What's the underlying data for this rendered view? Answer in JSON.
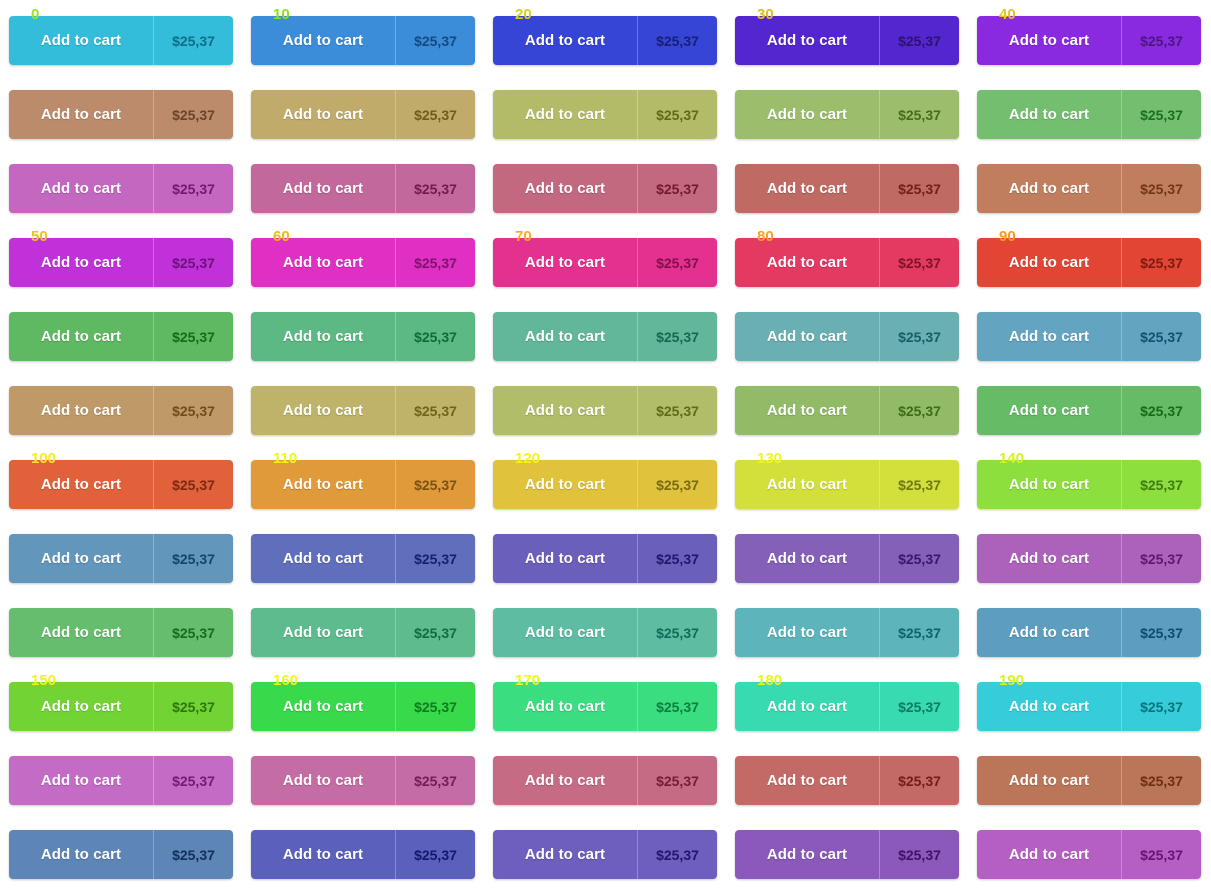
{
  "page": {
    "title": "Add to cart button color grid",
    "background": "#ffffff",
    "columns": 5,
    "rows": 12,
    "button_count": 60,
    "label_text": "Add to cart",
    "price_text": "$25,37",
    "label_text_color": "#ffffff",
    "index_label_stride": 10,
    "index_label_rows": [
      0,
      3,
      6,
      9
    ]
  },
  "buttons": [
    {
      "index": "0",
      "label": "Add to cart",
      "price": "$25,37",
      "bg": "#34bcdb",
      "price_color": "#0d6f86",
      "index_label": "0",
      "index_color": "#9ce61f"
    },
    {
      "index": "1",
      "label": "Add to cart",
      "price": "$25,37",
      "bg": "#3b8cd9",
      "price_color": "#124a80",
      "index_label": "10",
      "index_color": "#8ee01b"
    },
    {
      "index": "2",
      "label": "Add to cart",
      "price": "$25,37",
      "bg": "#3745d6",
      "price_color": "#161e78",
      "index_label": "20",
      "index_color": "#d8d315"
    },
    {
      "index": "3",
      "label": "Add to cart",
      "price": "$25,37",
      "bg": "#5426cf",
      "price_color": "#2c126f",
      "index_label": "30",
      "index_color": "#e0c014"
    },
    {
      "index": "4",
      "label": "Add to cart",
      "price": "$25,37",
      "bg": "#8a2ae0",
      "price_color": "#4a1680",
      "index_label": "40",
      "index_color": "#e8c419"
    },
    {
      "index": "5",
      "label": "Add to cart",
      "price": "$25,37",
      "bg": "#bb8b6b",
      "price_color": "#6b4428",
      "index_label": null,
      "index_color": null
    },
    {
      "index": "6",
      "label": "Add to cart",
      "price": "$25,37",
      "bg": "#c1ab6a",
      "price_color": "#6e5c19",
      "index_label": null,
      "index_color": null
    },
    {
      "index": "7",
      "label": "Add to cart",
      "price": "$25,37",
      "bg": "#b4bb68",
      "price_color": "#5e6a18",
      "index_label": null,
      "index_color": null
    },
    {
      "index": "8",
      "label": "Add to cart",
      "price": "$25,37",
      "bg": "#9cbd6c",
      "price_color": "#456d1c",
      "index_label": null,
      "index_color": null
    },
    {
      "index": "9",
      "label": "Add to cart",
      "price": "$25,37",
      "bg": "#74bf6f",
      "price_color": "#1c6e24",
      "index_label": null,
      "index_color": null
    },
    {
      "index": "10",
      "label": "Add to cart",
      "price": "$25,37",
      "bg": "#c367c1",
      "price_color": "#73186f",
      "index_label": null,
      "index_color": null
    },
    {
      "index": "11",
      "label": "Add to cart",
      "price": "$25,37",
      "bg": "#c2689d",
      "price_color": "#73194e",
      "index_label": null,
      "index_color": null
    },
    {
      "index": "12",
      "label": "Add to cart",
      "price": "$25,37",
      "bg": "#c2687f",
      "price_color": "#73182f",
      "index_label": null,
      "index_color": null
    },
    {
      "index": "13",
      "label": "Add to cart",
      "price": "$25,37",
      "bg": "#c06a64",
      "price_color": "#71211a",
      "index_label": null,
      "index_color": null
    },
    {
      "index": "14",
      "label": "Add to cart",
      "price": "$25,37",
      "bg": "#c07e5e",
      "price_color": "#703618",
      "index_label": null,
      "index_color": null
    },
    {
      "index": "15",
      "label": "Add to cart",
      "price": "$25,37",
      "bg": "#c031d9",
      "price_color": "#6a1279",
      "index_label": "50",
      "index_color": "#eec31c"
    },
    {
      "index": "16",
      "label": "Add to cart",
      "price": "$25,37",
      "bg": "#e030c4",
      "price_color": "#7d126b",
      "index_label": "60",
      "index_color": "#f1b81d"
    },
    {
      "index": "17",
      "label": "Add to cart",
      "price": "$25,37",
      "bg": "#e43190",
      "price_color": "#7c1249",
      "index_label": "70",
      "index_color": "#f2af20"
    },
    {
      "index": "18",
      "label": "Add to cart",
      "price": "$25,37",
      "bg": "#e43a62",
      "price_color": "#7c1428",
      "index_label": "80",
      "index_color": "#f4a41f"
    },
    {
      "index": "19",
      "label": "Add to cart",
      "price": "$25,37",
      "bg": "#e34535",
      "price_color": "#7b1a0f",
      "index_label": "90",
      "index_color": "#f69a1f"
    },
    {
      "index": "20",
      "label": "Add to cart",
      "price": "$25,37",
      "bg": "#5fb862",
      "price_color": "#116b1c",
      "index_label": null,
      "index_color": null
    },
    {
      "index": "21",
      "label": "Add to cart",
      "price": "$25,37",
      "bg": "#5cb983",
      "price_color": "#0e6c3c",
      "index_label": null,
      "index_color": null
    },
    {
      "index": "22",
      "label": "Add to cart",
      "price": "$25,37",
      "bg": "#62b79b",
      "price_color": "#116a52",
      "index_label": null,
      "index_color": null
    },
    {
      "index": "23",
      "label": "Add to cart",
      "price": "$25,37",
      "bg": "#6aafb2",
      "price_color": "#145f68",
      "index_label": null,
      "index_color": null
    },
    {
      "index": "24",
      "label": "Add to cart",
      "price": "$25,37",
      "bg": "#63a4c0",
      "price_color": "#13506f",
      "index_label": null,
      "index_color": null
    },
    {
      "index": "25",
      "label": "Add to cart",
      "price": "$25,37",
      "bg": "#bf9a68",
      "price_color": "#6f4d17",
      "index_label": null,
      "index_color": null
    },
    {
      "index": "26",
      "label": "Add to cart",
      "price": "$25,37",
      "bg": "#bfb369",
      "price_color": "#6e6417",
      "index_label": null,
      "index_color": null
    },
    {
      "index": "27",
      "label": "Add to cart",
      "price": "$25,37",
      "bg": "#b2bd69",
      "price_color": "#5c6c18",
      "index_label": null,
      "index_color": null
    },
    {
      "index": "28",
      "label": "Add to cart",
      "price": "$25,37",
      "bg": "#92bb67",
      "price_color": "#3c6c17",
      "index_label": null,
      "index_color": null
    },
    {
      "index": "29",
      "label": "Add to cart",
      "price": "$25,37",
      "bg": "#66bb67",
      "price_color": "#146c17",
      "index_label": null,
      "index_color": null
    },
    {
      "index": "30",
      "label": "Add to cart",
      "price": "$25,37",
      "bg": "#e0613a",
      "price_color": "#7d2812",
      "index_label": "100",
      "index_color": "#f7ec1c"
    },
    {
      "index": "31",
      "label": "Add to cart",
      "price": "$25,37",
      "bg": "#e09a3a",
      "price_color": "#7b5110",
      "index_label": "110",
      "index_color": "#f5f41b"
    },
    {
      "index": "32",
      "label": "Add to cart",
      "price": "$25,37",
      "bg": "#e0c23c",
      "price_color": "#7a6a0f",
      "index_label": "120",
      "index_color": "#f6f21d"
    },
    {
      "index": "33",
      "label": "Add to cart",
      "price": "$25,37",
      "bg": "#d3e03b",
      "price_color": "#6e7a10",
      "index_label": "130",
      "index_color": "#f2f41c"
    },
    {
      "index": "34",
      "label": "Add to cart",
      "price": "$25,37",
      "bg": "#8cdf3c",
      "price_color": "#3f7c10",
      "index_label": "140",
      "index_color": "#d6f31c"
    },
    {
      "index": "35",
      "label": "Add to cart",
      "price": "$25,37",
      "bg": "#6297bb",
      "price_color": "#13446c",
      "index_label": null,
      "index_color": null
    },
    {
      "index": "36",
      "label": "Add to cart",
      "price": "$25,37",
      "bg": "#5f6fbb",
      "price_color": "#161f6c",
      "index_label": null,
      "index_color": null
    },
    {
      "index": "37",
      "label": "Add to cart",
      "price": "$25,37",
      "bg": "#6a5fbb",
      "price_color": "#22166c",
      "index_label": null,
      "index_color": null
    },
    {
      "index": "38",
      "label": "Add to cart",
      "price": "$25,37",
      "bg": "#8460b9",
      "price_color": "#3c166a",
      "index_label": null,
      "index_color": null
    },
    {
      "index": "39",
      "label": "Add to cart",
      "price": "$25,37",
      "bg": "#ac62ba",
      "price_color": "#62156b",
      "index_label": null,
      "index_color": null
    },
    {
      "index": "40",
      "label": "Add to cart",
      "price": "$25,37",
      "bg": "#66bd6d",
      "price_color": "#146c1e",
      "index_label": null,
      "index_color": null
    },
    {
      "index": "41",
      "label": "Add to cart",
      "price": "$25,37",
      "bg": "#5dbb8d",
      "price_color": "#0f6c44",
      "index_label": null,
      "index_color": null
    },
    {
      "index": "42",
      "label": "Add to cart",
      "price": "$25,37",
      "bg": "#5dbca2",
      "price_color": "#0f6c58",
      "index_label": null,
      "index_color": null
    },
    {
      "index": "43",
      "label": "Add to cart",
      "price": "$25,37",
      "bg": "#5eb4bb",
      "price_color": "#0f636c",
      "index_label": null,
      "index_color": null
    },
    {
      "index": "44",
      "label": "Add to cart",
      "price": "$25,37",
      "bg": "#5d9ec0",
      "price_color": "#0f4b6f",
      "index_label": null,
      "index_color": null
    },
    {
      "index": "45",
      "label": "Add to cart",
      "price": "$25,37",
      "bg": "#72d335",
      "price_color": "#2d7511",
      "index_label": "150",
      "index_color": "#f4f21c"
    },
    {
      "index": "46",
      "label": "Add to cart",
      "price": "$25,37",
      "bg": "#38d94a",
      "price_color": "#117a1e",
      "index_label": "160",
      "index_color": "#f3f41d"
    },
    {
      "index": "47",
      "label": "Add to cart",
      "price": "$25,37",
      "bg": "#3add7f",
      "price_color": "#107c42",
      "index_label": "170",
      "index_color": "#eff61e"
    },
    {
      "index": "48",
      "label": "Add to cart",
      "price": "$25,37",
      "bg": "#38dab1",
      "price_color": "#0f7a5f",
      "index_label": "180",
      "index_color": "#e8f41e"
    },
    {
      "index": "49",
      "label": "Add to cart",
      "price": "$25,37",
      "bg": "#35cdda",
      "price_color": "#0d717a",
      "index_label": "190",
      "index_color": "#d9f31f"
    },
    {
      "index": "50",
      "label": "Add to cart",
      "price": "$25,37",
      "bg": "#c46bc6",
      "price_color": "#741a75",
      "index_label": null,
      "index_color": null
    },
    {
      "index": "51",
      "label": "Add to cart",
      "price": "$25,37",
      "bg": "#c46ca4",
      "price_color": "#751b55",
      "index_label": null,
      "index_color": null
    },
    {
      "index": "52",
      "label": "Add to cart",
      "price": "$25,37",
      "bg": "#c56c84",
      "price_color": "#761b33",
      "index_label": null,
      "index_color": null
    },
    {
      "index": "53",
      "label": "Add to cart",
      "price": "$25,37",
      "bg": "#c36a66",
      "price_color": "#741b1c",
      "index_label": null,
      "index_color": null
    },
    {
      "index": "54",
      "label": "Add to cart",
      "price": "$25,37",
      "bg": "#bb7558",
      "price_color": "#6c2e14",
      "index_label": null,
      "index_color": null
    },
    {
      "index": "55",
      "label": "Add to cart",
      "price": "$25,37",
      "bg": "#5d85b6",
      "price_color": "#102f5f",
      "index_label": null,
      "index_color": null
    },
    {
      "index": "56",
      "label": "Add to cart",
      "price": "$25,37",
      "bg": "#5a60bc",
      "price_color": "#14186c",
      "index_label": null,
      "index_color": null
    },
    {
      "index": "57",
      "label": "Add to cart",
      "price": "$25,37",
      "bg": "#6e5ebd",
      "price_color": "#25146c",
      "index_label": null,
      "index_color": null
    },
    {
      "index": "58",
      "label": "Add to cart",
      "price": "$25,37",
      "bg": "#8b59ba",
      "price_color": "#431069",
      "index_label": null,
      "index_color": null
    },
    {
      "index": "59",
      "label": "Add to cart",
      "price": "$25,37",
      "bg": "#b55fc4",
      "price_color": "#6a1272",
      "index_label": null,
      "index_color": null
    }
  ]
}
